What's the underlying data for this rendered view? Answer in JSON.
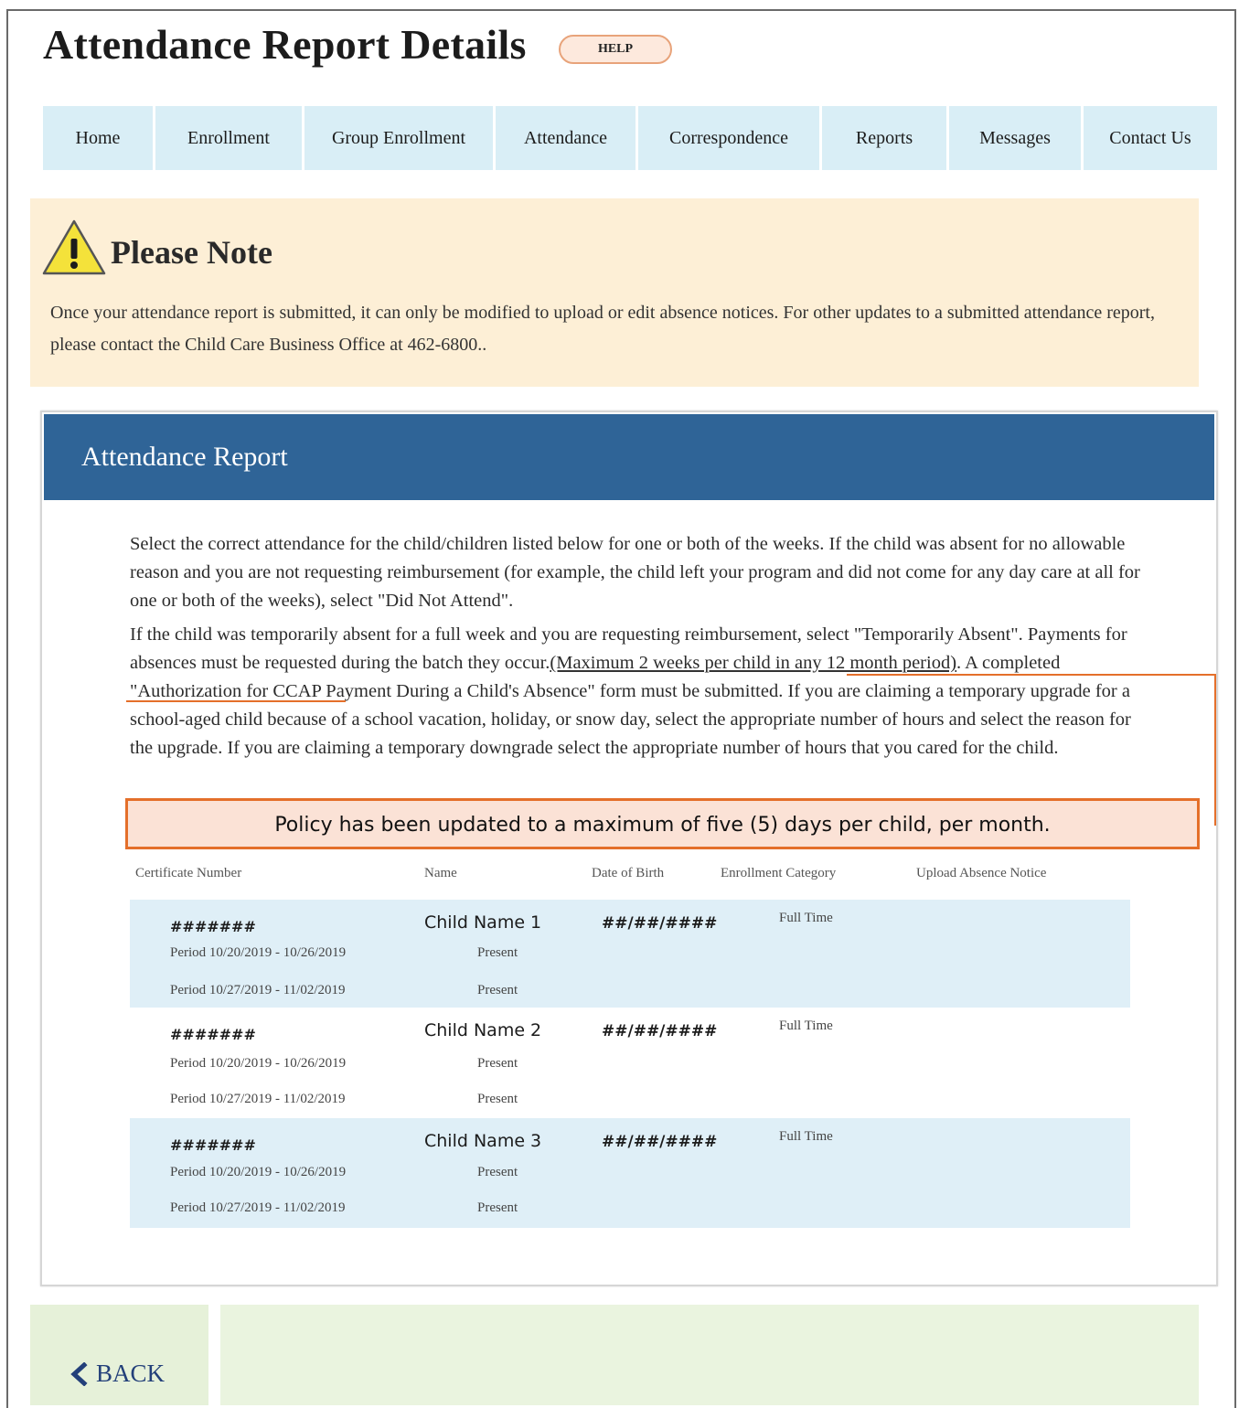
{
  "page": {
    "title": "Attendance Report Details",
    "help_label": "HELP"
  },
  "nav": {
    "items": [
      {
        "label": "Home"
      },
      {
        "label": "Enrollment"
      },
      {
        "label": "Group Enrollment"
      },
      {
        "label": "Attendance"
      },
      {
        "label": "Correspondence"
      },
      {
        "label": "Reports"
      },
      {
        "label": "Messages"
      },
      {
        "label": "Contact Us"
      }
    ]
  },
  "note": {
    "icon": "warning-icon",
    "title": "Please Note",
    "text": "Once your attendance report is submitted, it can only be modified to upload or edit absence notices. For other updates to a submitted attendance report, please contact the Child Care Business Office at 462-6800.."
  },
  "report": {
    "title": "Attendance Report",
    "paragraph1": "Select the correct attendance for the child/children listed below for one or both of the weeks. If the child was absent for no allowable reason and you are not requesting reimbursement (for example, the child left your program and did not come for any day care at all for one or both of the weeks), select \"Did Not Attend\".",
    "paragraph2_a": "If the child was temporarily absent for a full week and you are requesting reimbursement, select \"Temporarily Absent\". Payments for absences must be requested during the batch they occur.",
    "paragraph2_underlined": "(Maximum 2 weeks per child in any 12 month period)",
    "paragraph2_b": ". A completed \"Authorization for CCAP Payment During a Child's Absence\" form must be submitted. If you are claiming a temporary upgrade for a school-aged child because of a school vacation, holiday, or snow day, select the appropriate number of hours and select the reason for the upgrade. If you are claiming a temporary downgrade select the appropriate number of hours that you cared for the child.",
    "policy_callout": "Policy has been updated to a maximum of five (5) days per child, per month.",
    "columns": {
      "certificate": "Certificate Number",
      "name": "Name",
      "dob": "Date of Birth",
      "category": "Enrollment Category",
      "upload": "Upload Absence Notice"
    },
    "rows": [
      {
        "certificate": "#######",
        "name": "Child Name 1",
        "dob": "##/##/####",
        "category": "Full Time",
        "period1": "Period 10/20/2019 - 10/26/2019",
        "status1": "Present",
        "period2": "Period 10/27/2019 - 11/02/2019",
        "status2": "Present"
      },
      {
        "certificate": "#######",
        "name": "Child Name 2",
        "dob": "##/##/####",
        "category": "Full Time",
        "period1": "Period 10/20/2019 - 10/26/2019",
        "status1": "Present",
        "period2": "Period 10/27/2019 - 11/02/2019",
        "status2": "Present"
      },
      {
        "certificate": "#######",
        "name": "Child Name 3",
        "dob": "##/##/####",
        "category": "Full Time",
        "period1": "Period 10/20/2019 - 10/26/2019",
        "status1": "Present",
        "period2": "Period 10/27/2019 - 11/02/2019",
        "status2": "Present"
      }
    ]
  },
  "footer": {
    "back_label": "BACK",
    "back_icon": "chevron-left-icon"
  },
  "colors": {
    "nav_bg": "#d9eef6",
    "note_bg": "#fdefd6",
    "report_header": "#2f6497",
    "highlight_border": "#e46f2a",
    "policy_bg": "#fbe2d6",
    "row_shade": "#dfeff7",
    "footer_bg": "#e6f1d9"
  }
}
